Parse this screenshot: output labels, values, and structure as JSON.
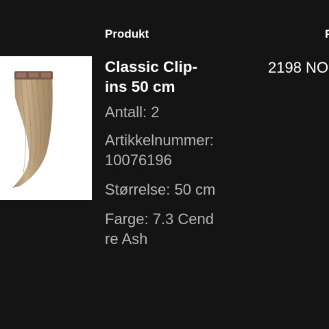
{
  "headers": {
    "product": "Produkt",
    "price": "P"
  },
  "item": {
    "image_icon": "hair-extension-image",
    "title": "Classic Clip-ins 50 cm",
    "quantity": "Antall: 2",
    "article_number": "Artikkelnummer: 10076196",
    "size": "Størrelse: 50 cm",
    "color": "Farge: 7.3 Cendre Ash",
    "price": "2198 NO"
  },
  "colors": {
    "background": "#141414",
    "text_primary": "#ffffff",
    "text_secondary": "#b3b3b3",
    "image_background": "#ffffff"
  }
}
